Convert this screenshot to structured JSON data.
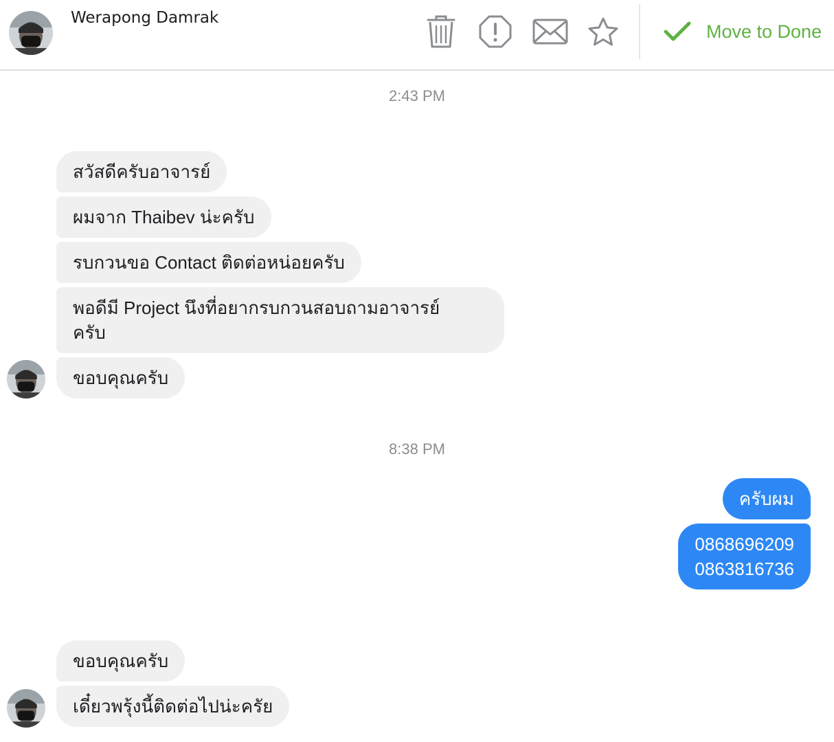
{
  "header": {
    "contact_name": "Werapong Damrak",
    "icons": [
      "trash-icon",
      "report-icon",
      "mail-icon",
      "star-icon"
    ],
    "done_label": "Move to Done",
    "accent_color": "#5fb143"
  },
  "conversation": {
    "timestamps": [
      "2:43 PM",
      "8:38 PM"
    ],
    "group1": [
      "สวัสดีครับอาจารย์",
      "ผมจาก Thaibev น่ะครับ",
      "รบกวนขอ Contact ติดต่อหน่อยครับ",
      "พอดีมี Project นึงที่อยากรบกวนสอบถามอาจารย์",
      "ครับ",
      "ขอบคุณครับ"
    ],
    "group2_outgoing": [
      "ครับผม",
      "0868696209",
      "0863816736"
    ],
    "group3": [
      "ขอบคุณครับ",
      "เดี๋ยวพรุ้งนี้ติดต่อไปน่ะครัย"
    ],
    "colors": {
      "incoming_bubble": "#f0f0f0",
      "outgoing_bubble": "#2d88f5",
      "timestamp_text": "#8a8d91"
    }
  }
}
